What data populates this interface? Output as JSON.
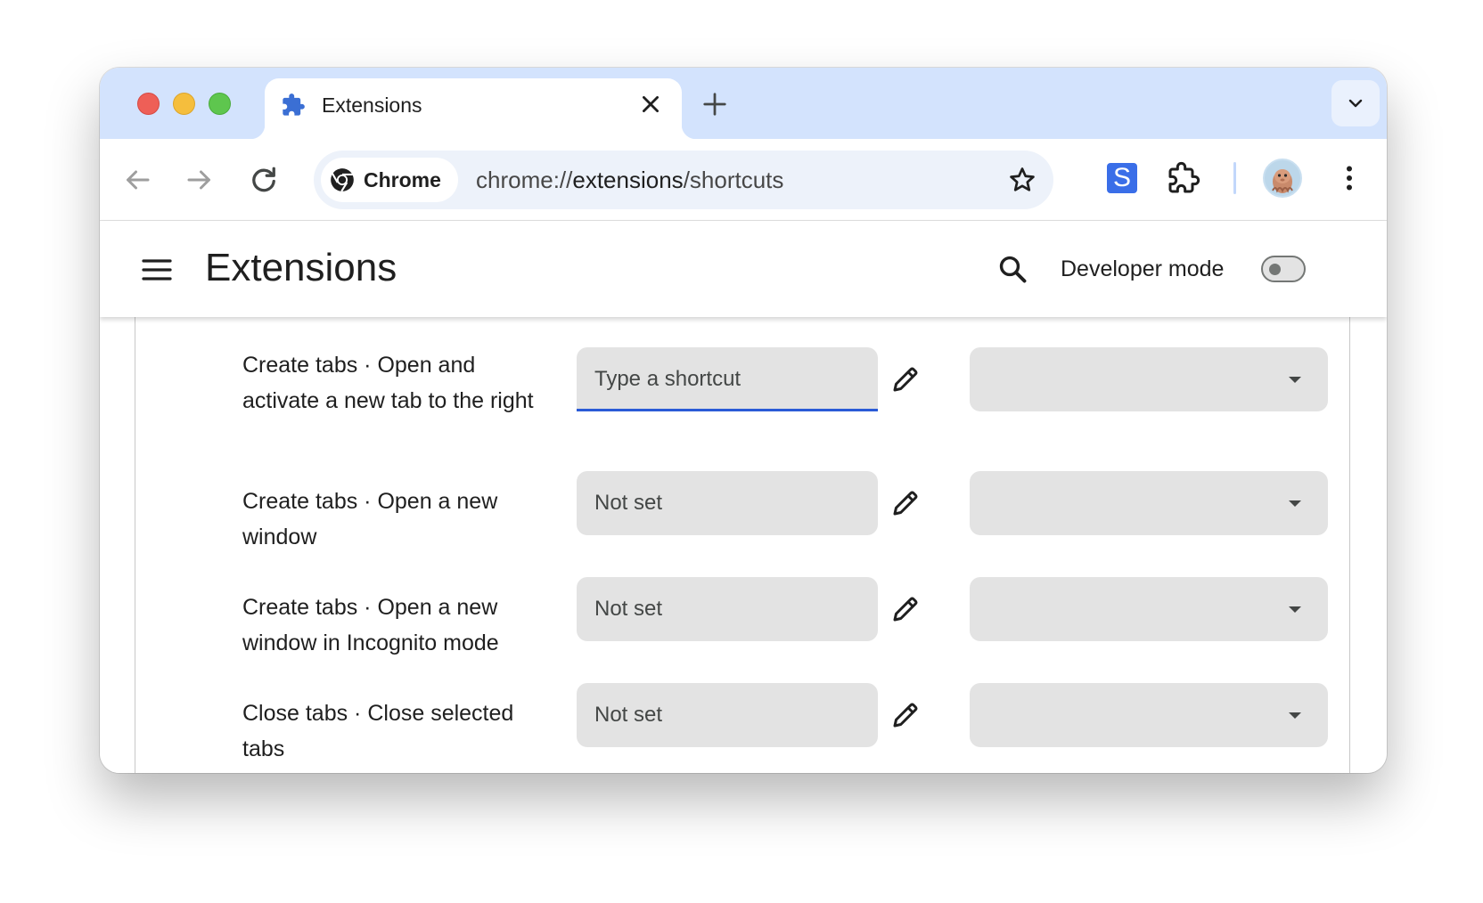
{
  "tab": {
    "title": "Extensions",
    "icon": "puzzle-icon"
  },
  "omnibox": {
    "chip_label": "Chrome",
    "url_prefix": "chrome://",
    "url_host": "extensions",
    "url_path": "/shortcuts"
  },
  "toolbar": {
    "extension_letter": "S"
  },
  "header": {
    "title": "Extensions",
    "developer_mode_label": "Developer mode",
    "developer_mode_on": false
  },
  "shortcuts": [
    {
      "label": "Create tabs · Open and activate a new tab to the right",
      "value": "Type a shortcut",
      "active": true,
      "scope": ""
    },
    {
      "label": "Create tabs · Open a new window",
      "value": "Not set",
      "active": false,
      "scope": ""
    },
    {
      "label": "Create tabs · Open a new window in Incognito mode",
      "value": "Not set",
      "active": false,
      "scope": ""
    },
    {
      "label": "Close tabs · Close selected tabs",
      "value": "Not set",
      "active": false,
      "scope": ""
    }
  ],
  "colors": {
    "tabstrip": "#d3e3fd",
    "accent": "#2a5bd7",
    "field": "#e3e3e3"
  }
}
